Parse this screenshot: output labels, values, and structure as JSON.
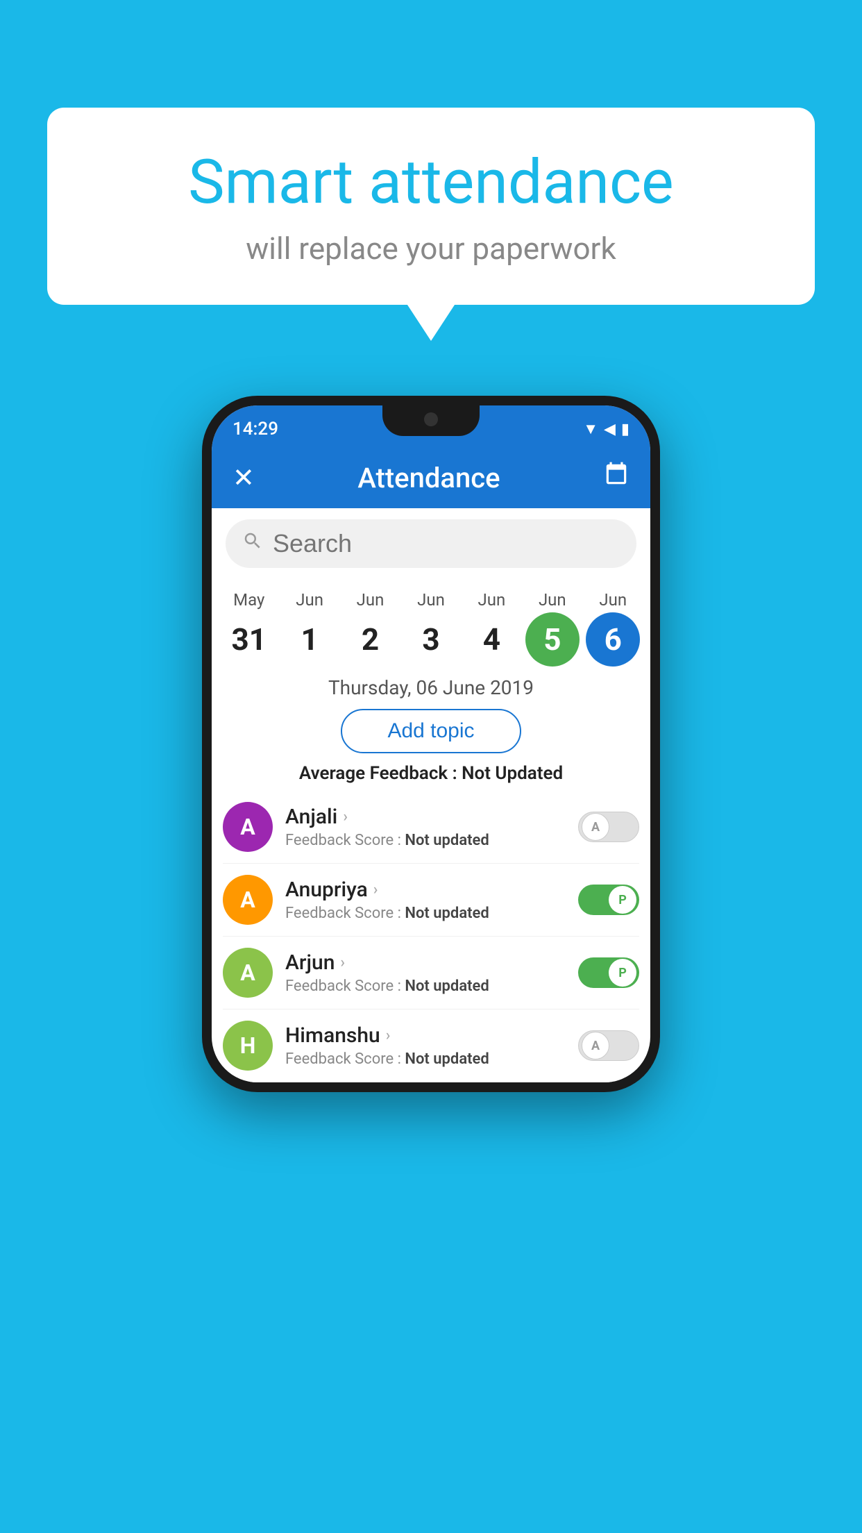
{
  "background_color": "#1ab8e8",
  "speech_bubble": {
    "main_title": "Smart attendance",
    "sub_title": "will replace your paperwork"
  },
  "phone": {
    "status_bar": {
      "time": "14:29",
      "icons": "▼◀▮"
    },
    "app_bar": {
      "title": "Attendance",
      "close_icon": "✕",
      "calendar_icon": "📅"
    },
    "search": {
      "placeholder": "Search"
    },
    "calendar": {
      "days": [
        {
          "month": "May",
          "date": "31",
          "state": "normal"
        },
        {
          "month": "Jun",
          "date": "1",
          "state": "normal"
        },
        {
          "month": "Jun",
          "date": "2",
          "state": "normal"
        },
        {
          "month": "Jun",
          "date": "3",
          "state": "normal"
        },
        {
          "month": "Jun",
          "date": "4",
          "state": "normal"
        },
        {
          "month": "Jun",
          "date": "5",
          "state": "today"
        },
        {
          "month": "Jun",
          "date": "6",
          "state": "selected"
        }
      ]
    },
    "selected_date": "Thursday, 06 June 2019",
    "add_topic_label": "Add topic",
    "avg_feedback_label": "Average Feedback : ",
    "avg_feedback_value": "Not Updated",
    "students": [
      {
        "name": "Anjali",
        "avatar_letter": "A",
        "avatar_color": "#9c27b0",
        "feedback_label": "Feedback Score : ",
        "feedback_value": "Not updated",
        "attendance": "absent",
        "toggle_letter": "A"
      },
      {
        "name": "Anupriya",
        "avatar_letter": "A",
        "avatar_color": "#ff9800",
        "feedback_label": "Feedback Score : ",
        "feedback_value": "Not updated",
        "attendance": "present",
        "toggle_letter": "P"
      },
      {
        "name": "Arjun",
        "avatar_letter": "A",
        "avatar_color": "#8bc34a",
        "feedback_label": "Feedback Score : ",
        "feedback_value": "Not updated",
        "attendance": "present",
        "toggle_letter": "P"
      },
      {
        "name": "Himanshu",
        "avatar_letter": "H",
        "avatar_color": "#8bc34a",
        "feedback_label": "Feedback Score : ",
        "feedback_value": "Not updated",
        "attendance": "absent",
        "toggle_letter": "A"
      }
    ]
  }
}
